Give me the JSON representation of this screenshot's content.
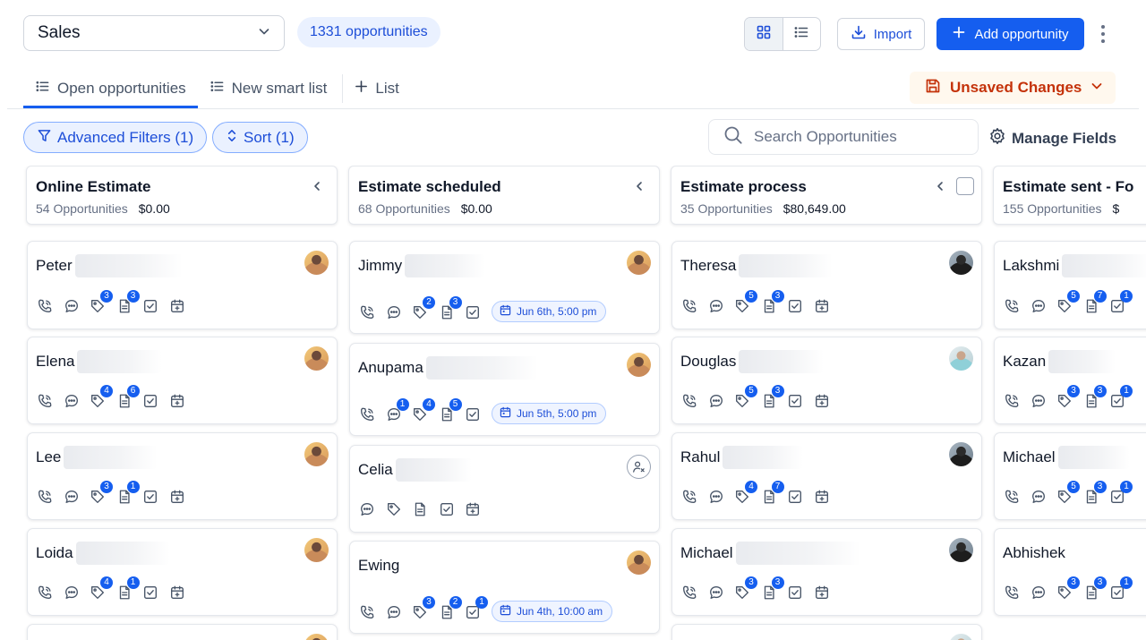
{
  "header": {
    "pipeline": "Sales",
    "count_label": "1331 opportunities",
    "import_label": "Import",
    "add_label": "Add opportunity"
  },
  "tabs": [
    {
      "label": "Open opportunities",
      "icon": "list-icon"
    },
    {
      "label": "New smart list",
      "icon": "list-icon"
    },
    {
      "label": "List",
      "icon": "plus-icon"
    }
  ],
  "unsaved_label": "Unsaved Changes",
  "filters": {
    "advanced_label": "Advanced Filters (1)",
    "sort_label": "Sort (1)",
    "search_placeholder": "Search Opportunities",
    "manage_fields_label": "Manage Fields"
  },
  "colors": {
    "accent": "#155eef",
    "chip_bg": "#eaf1ff",
    "unsaved_text": "#c4320a",
    "unsaved_bg": "#fff8ee"
  },
  "columns": [
    {
      "title": "Online Estimate",
      "count": "54 Opportunities",
      "amount": "$0.00",
      "cards": [
        {
          "name": "Peter",
          "avatar": "tan",
          "icons": [
            "phone",
            "chat",
            "tag:3",
            "doc:3",
            "check",
            "calendar"
          ]
        },
        {
          "name": "Elena",
          "avatar": "tan",
          "icons": [
            "phone",
            "chat",
            "tag:4",
            "doc:6",
            "check",
            "calendar"
          ]
        },
        {
          "name": "Lee",
          "avatar": "tan",
          "icons": [
            "phone",
            "chat",
            "tag:3",
            "doc:1",
            "check",
            "calendar"
          ]
        },
        {
          "name": "Loida",
          "avatar": "tan",
          "icons": [
            "phone",
            "chat",
            "tag:4",
            "doc:1",
            "check",
            "calendar"
          ]
        },
        {
          "name": "",
          "avatar": "tan",
          "icons": []
        }
      ]
    },
    {
      "title": "Estimate scheduled",
      "count": "68 Opportunities",
      "amount": "$0.00",
      "cards": [
        {
          "name": "Jimmy",
          "avatar": "tan",
          "icons": [
            "phone",
            "chat",
            "tag:2",
            "doc:3",
            "check"
          ],
          "appointment": "Jun 6th, 5:00 pm"
        },
        {
          "name": "Anupama",
          "avatar": "tan",
          "icons": [
            "phone",
            "chat:1",
            "tag:4",
            "doc:5",
            "check"
          ],
          "appointment": "Jun 5th, 5:00 pm"
        },
        {
          "name": "Celia",
          "avatar": "unassigned",
          "icons": [
            "chat",
            "tag",
            "doc",
            "check",
            "calendar"
          ]
        },
        {
          "name": "Ewing",
          "avatar": "tan",
          "icons": [
            "phone",
            "chat",
            "tag:3",
            "doc:2",
            "check:1"
          ],
          "appointment": "Jun 4th, 10:00 am"
        }
      ]
    },
    {
      "title": "Estimate process",
      "count": "35 Opportunities",
      "amount": "$80,649.00",
      "cards": [
        {
          "name": "Theresa",
          "avatar": "dark",
          "icons": [
            "phone",
            "chat",
            "tag:5",
            "doc:3",
            "check",
            "calendar"
          ]
        },
        {
          "name": "Douglas",
          "avatar": "light",
          "icons": [
            "phone",
            "chat",
            "tag:5",
            "doc:3",
            "check",
            "calendar"
          ]
        },
        {
          "name": "Rahul",
          "avatar": "dark",
          "icons": [
            "phone",
            "chat",
            "tag:4",
            "doc:7",
            "check",
            "calendar"
          ]
        },
        {
          "name": "Michael",
          "avatar": "dark",
          "icons": [
            "phone",
            "chat",
            "tag:3",
            "doc:3",
            "check",
            "calendar"
          ]
        },
        {
          "name": "",
          "avatar": "light",
          "icons": []
        }
      ]
    },
    {
      "title": "Estimate sent - Fo",
      "count": "155 Opportunities",
      "amount": "$",
      "cards": [
        {
          "name": "Lakshmi",
          "avatar": "none",
          "icons": [
            "phone",
            "chat",
            "tag:5",
            "doc:7",
            "check:1"
          ]
        },
        {
          "name": "Kazan",
          "avatar": "none",
          "icons": [
            "phone",
            "chat",
            "tag:3",
            "doc:3",
            "check:1"
          ]
        },
        {
          "name": "Michael",
          "avatar": "none",
          "icons": [
            "phone",
            "chat",
            "tag:5",
            "doc:3",
            "check:1"
          ]
        },
        {
          "name": "Abhishek",
          "avatar": "none",
          "icons": [
            "phone",
            "chat",
            "tag:3",
            "doc:3",
            "check:1"
          ]
        }
      ]
    }
  ]
}
